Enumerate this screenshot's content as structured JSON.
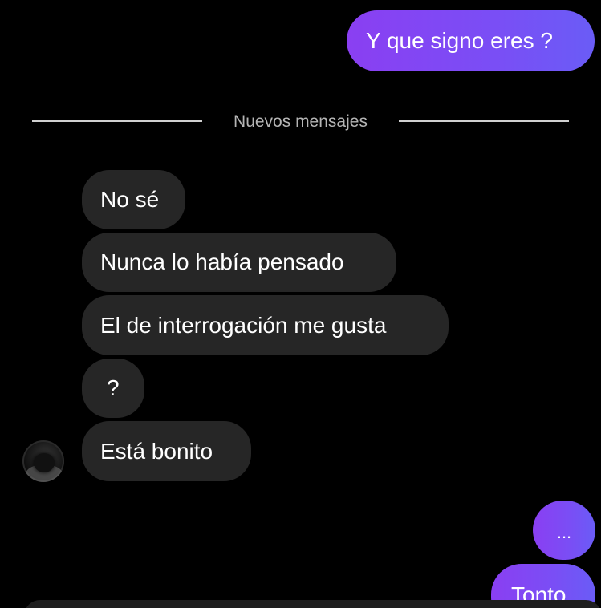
{
  "chat": {
    "divider_label": "Nuevos mensajes",
    "sent_top": "Y que signo eres ?",
    "received": [
      "No sé",
      "Nunca lo había pensado",
      "El de interrogación me gusta",
      "?",
      "Está bonito"
    ],
    "sent_bottom": [
      "...",
      "Tonto"
    ]
  },
  "colors": {
    "sent_bubble": "#7a4ef5",
    "received_bubble": "#262626",
    "background": "#000000",
    "text": "#ffffff"
  }
}
